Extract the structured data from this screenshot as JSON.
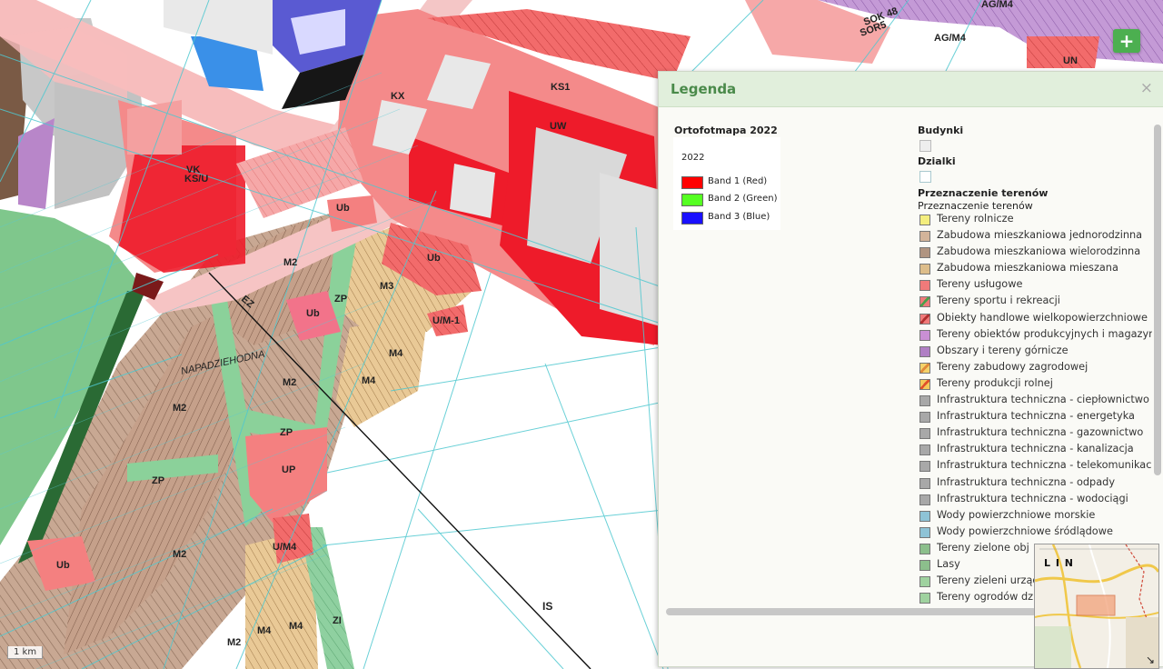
{
  "map_labels": {
    "xk": "KX",
    "ks1": "KS1",
    "uw": "UW",
    "ks_t": "KS/U",
    "vk": "VK",
    "ub_top": "Ub",
    "m2_a": "M2",
    "ub_mid": "Ub",
    "zp_a": "ZP",
    "m3": "M3",
    "ub_right": "Ub",
    "uzm": "U/M-1",
    "m4_a": "M4",
    "m4_b": "M4",
    "m2_b": "M2",
    "m2_c": "M2",
    "zp_b": "ZP",
    "up": "UP",
    "zp_c": "ZP",
    "m2_d": "M2",
    "ub_low": "Ub",
    "umm": "U/M4",
    "zi": "ZI",
    "m4_c": "M4",
    "m4_d": "M4",
    "m2_e": "M2",
    "is": "IS",
    "ez": "EZ",
    "street": "NAPADZIEHODNA",
    "ag1": "AG/M4",
    "ag2": "AG/M4",
    "un": "UN",
    "sok": "SOK 48",
    "sor": "SOR5"
  },
  "scale_label": "1 km",
  "add_button": "+",
  "legend": {
    "title": "Legenda",
    "close": "×",
    "ortho": {
      "title": "Ortofotmapa 2022",
      "year": "2022",
      "bands": [
        {
          "label": "Band 1 (Red)",
          "color": "#ff0000"
        },
        {
          "label": "Band 2 (Green)",
          "color": "#55ff22"
        },
        {
          "label": "Band 3 (Blue)",
          "color": "#1a10ff"
        }
      ]
    },
    "budynki": "Budynki",
    "dzialki": "Dzialki",
    "przeznaczenie_title": "Przeznaczenie terenów",
    "przeznaczenie_sub": "Przeznaczenie terenów",
    "items": [
      {
        "label": "Tereny rolnicze",
        "color": "#f4ee7e"
      },
      {
        "label": "Zabudowa mieszkaniowa jednorodzinna",
        "color": "#d3b49a"
      },
      {
        "label": "Zabudowa mieszkaniowa wielorodzinna",
        "color": "#b09480"
      },
      {
        "label": "Zabudowa mieszkaniowa mieszana",
        "color": "#ddbd8a"
      },
      {
        "label": "Tereny usługowe",
        "color": "#f07a7a"
      },
      {
        "label": "Tereny sportu i rekreacji",
        "color": "#f07a7a",
        "hatch": "#4aa04a"
      },
      {
        "label": "Obiekty handlowe wielkopowierzchniowe",
        "color": "#f07a7a",
        "hatch": "#b03030"
      },
      {
        "label": "Tereny obiektów produkcyjnych i magazyn",
        "color": "#c98fd4"
      },
      {
        "label": "Obszary i tereny górnicze",
        "color": "#b07fc4"
      },
      {
        "label": "Tereny zabudowy zagrodowej",
        "color": "#f4d26a",
        "hatch": "#e08a3a"
      },
      {
        "label": "Tereny produkcji rolnej",
        "color": "#f4c95a",
        "hatch": "#e0502a"
      },
      {
        "label": "Infrastruktura techniczna - ciepłownictwo",
        "color": "#a8a8a8"
      },
      {
        "label": "Infrastruktura techniczna - energetyka",
        "color": "#a8a8a8"
      },
      {
        "label": "Infrastruktura techniczna - gazownictwo",
        "color": "#a8a8a8"
      },
      {
        "label": "Infrastruktura techniczna - kanalizacja",
        "color": "#a8a8a8"
      },
      {
        "label": "Infrastruktura techniczna - telekomunikac",
        "color": "#a8a8a8"
      },
      {
        "label": "Infrastruktura techniczna - odpady",
        "color": "#a8a8a8"
      },
      {
        "label": "Infrastruktura techniczna - wodociągi",
        "color": "#a8a8a8"
      },
      {
        "label": "Wody powierzchniowe morskie",
        "color": "#8ec3d6"
      },
      {
        "label": "Wody powierzchniowe śródlądowe",
        "color": "#8ec3d6"
      },
      {
        "label": "Tereny zielone obj",
        "color": "#8cbf8c"
      },
      {
        "label": "Lasy",
        "color": "#8cbf8c"
      },
      {
        "label": "Tereny zieleni urząd",
        "color": "#9fd29f"
      },
      {
        "label": "Tereny ogrodów dzi",
        "color": "#9fd29f"
      }
    ]
  },
  "minimap": {
    "label": "L I N",
    "expand": "↘"
  }
}
